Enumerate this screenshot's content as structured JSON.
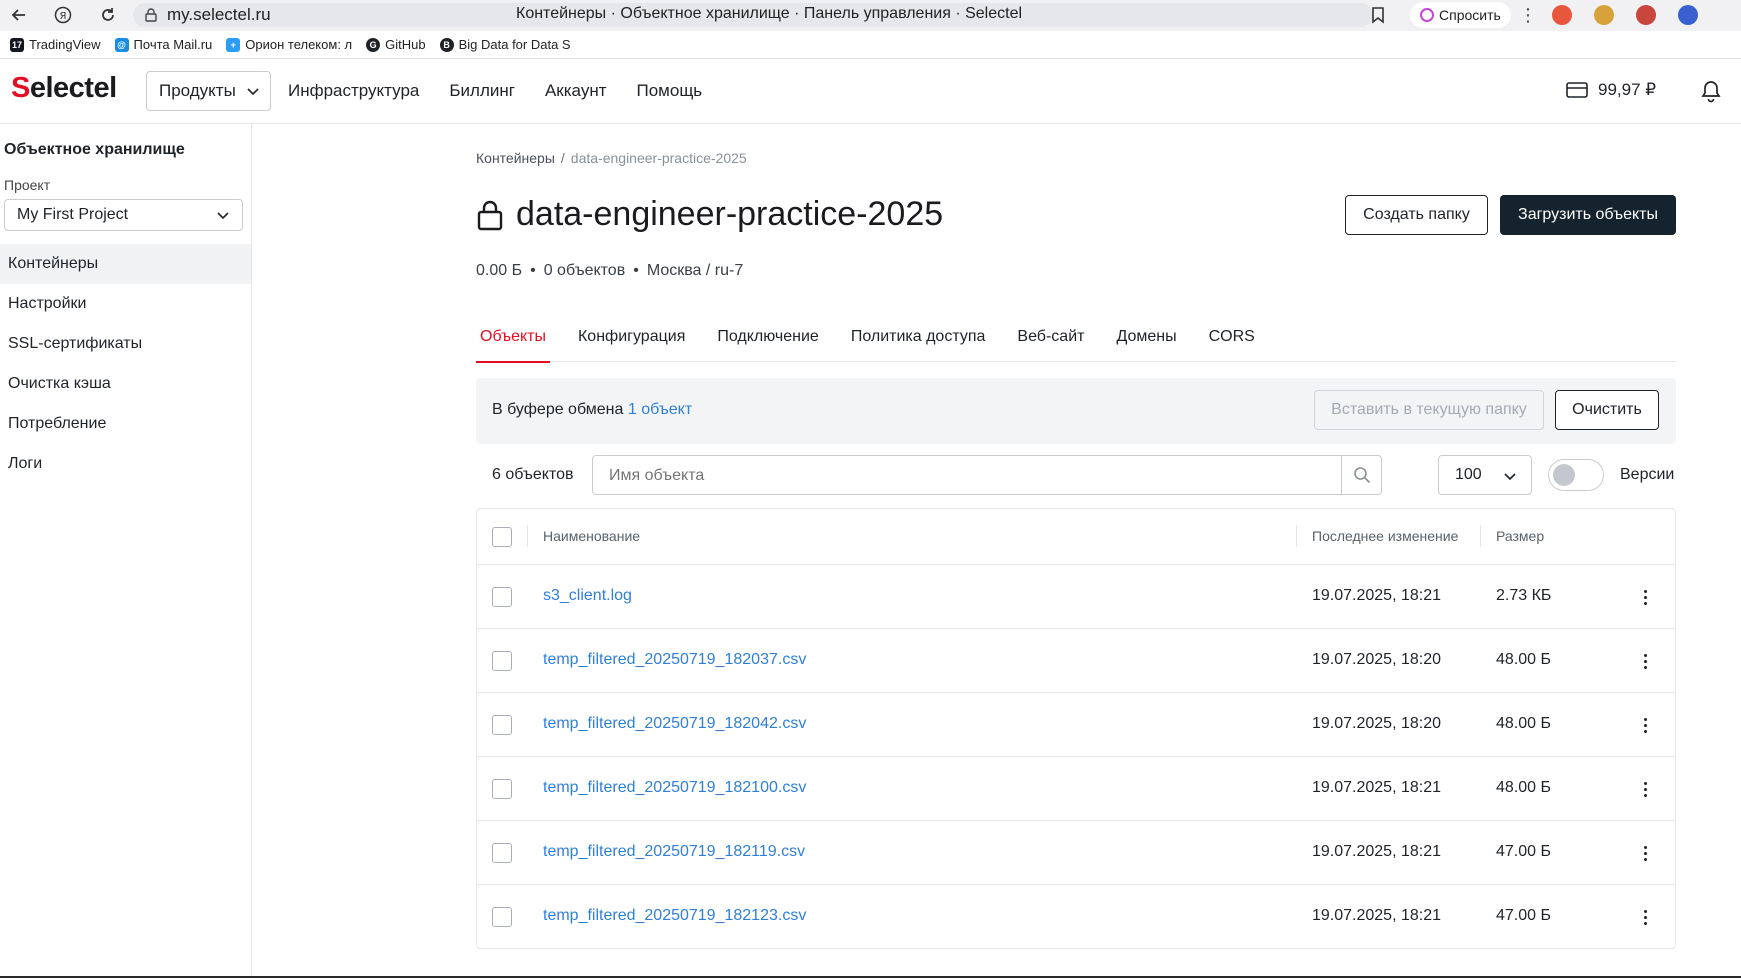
{
  "browser": {
    "url": "my.selectel.ru",
    "page_title": "Контейнеры · Объектное хранилище · Панель управления · Selectel",
    "ask_label": "Спросить",
    "bookmarks": [
      {
        "label": "TradingView",
        "icon": "tradingview-icon",
        "color": "#131722"
      },
      {
        "label": "Почта Mail.ru",
        "icon": "mail-icon",
        "color": "#168de2"
      },
      {
        "label": "Орион телеком: л",
        "icon": "orion-icon",
        "color": "#2a9df4"
      },
      {
        "label": "GitHub",
        "icon": "github-icon",
        "color": "#1f2328"
      },
      {
        "label": "Big Data for Data S",
        "icon": "bigdata-icon",
        "color": "#1f2328"
      }
    ]
  },
  "header": {
    "logo_first": "S",
    "logo_rest": "electel",
    "products_label": "Продукты",
    "nav": [
      "Инфраструктура",
      "Биллинг",
      "Аккаунт",
      "Помощь"
    ],
    "balance": "99,97 ₽",
    "accent_color": "#e30e22"
  },
  "sidebar": {
    "title": "Объектное хранилище",
    "project_label": "Проект",
    "project_value": "My First Project",
    "items": [
      {
        "label": "Контейнеры",
        "active": true
      },
      {
        "label": "Настройки",
        "active": false
      },
      {
        "label": "SSL-сертификаты",
        "active": false
      },
      {
        "label": "Очистка кэша",
        "active": false
      },
      {
        "label": "Потребление",
        "active": false
      },
      {
        "label": "Логи",
        "active": false
      }
    ]
  },
  "main": {
    "breadcrumb": {
      "parent": "Контейнеры",
      "separator": "/",
      "current": "data-engineer-practice-2025"
    },
    "title": "data-engineer-practice-2025",
    "create_folder_label": "Создать папку",
    "upload_label": "Загрузить объекты",
    "meta": {
      "size": "0.00 Б",
      "objects": "0 объектов",
      "location": "Москва / ru-7",
      "dot": "•"
    },
    "tabs": [
      {
        "label": "Объекты",
        "active": true
      },
      {
        "label": "Конфигурация",
        "active": false
      },
      {
        "label": "Подключение",
        "active": false
      },
      {
        "label": "Политика доступа",
        "active": false
      },
      {
        "label": "Веб-сайт",
        "active": false
      },
      {
        "label": "Домены",
        "active": false
      },
      {
        "label": "CORS",
        "active": false
      }
    ],
    "clipboard": {
      "text": "В буфере обмена",
      "link": "1 объект",
      "paste_label": "Вставить в текущую папку",
      "clear_label": "Очистить"
    },
    "toolbar": {
      "count": "6 объектов",
      "search_placeholder": "Имя объекта",
      "per_page": "100",
      "versions_label": "Версии"
    },
    "table": {
      "columns": [
        "Наименование",
        "Последнее изменение",
        "Размер"
      ],
      "rows": [
        {
          "name": "s3_client.log",
          "modified": "19.07.2025, 18:21",
          "size": "2.73 КБ"
        },
        {
          "name": "temp_filtered_20250719_182037.csv",
          "modified": "19.07.2025, 18:20",
          "size": "48.00 Б"
        },
        {
          "name": "temp_filtered_20250719_182042.csv",
          "modified": "19.07.2025, 18:20",
          "size": "48.00 Б"
        },
        {
          "name": "temp_filtered_20250719_182100.csv",
          "modified": "19.07.2025, 18:21",
          "size": "48.00 Б"
        },
        {
          "name": "temp_filtered_20250719_182119.csv",
          "modified": "19.07.2025, 18:21",
          "size": "47.00 Б"
        },
        {
          "name": "temp_filtered_20250719_182123.csv",
          "modified": "19.07.2025, 18:21",
          "size": "47.00 Б"
        }
      ]
    }
  }
}
